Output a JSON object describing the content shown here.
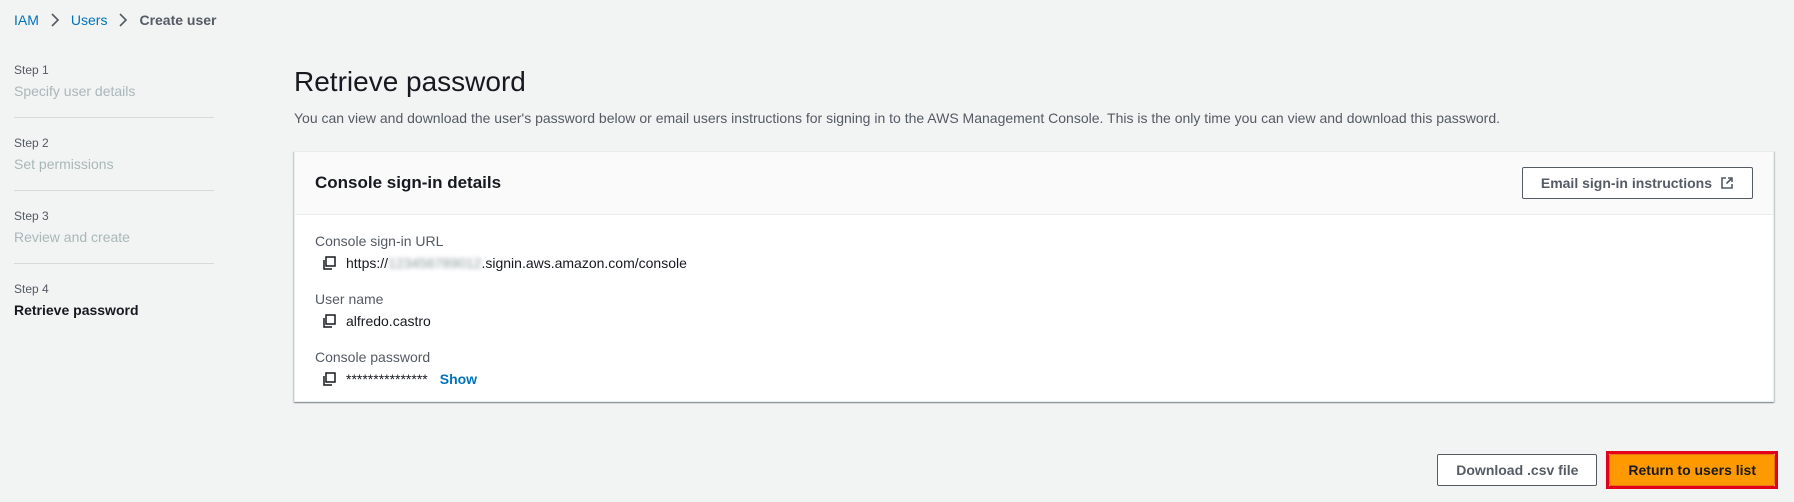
{
  "breadcrumb": {
    "items": [
      "IAM",
      "Users"
    ],
    "current": "Create user"
  },
  "steps": [
    {
      "num": "Step 1",
      "title": "Specify user details",
      "active": false
    },
    {
      "num": "Step 2",
      "title": "Set permissions",
      "active": false
    },
    {
      "num": "Step 3",
      "title": "Review and create",
      "active": false
    },
    {
      "num": "Step 4",
      "title": "Retrieve password",
      "active": true
    }
  ],
  "main": {
    "title": "Retrieve password",
    "description": "You can view and download the user's password below or email users instructions for signing in to the AWS Management Console. This is the only time you can view and download this password."
  },
  "panel": {
    "title": "Console sign-in details",
    "email_button": "Email sign-in instructions",
    "url_label": "Console sign-in URL",
    "url_prefix": "https://",
    "url_account": "123456789012",
    "url_suffix": ".signin.aws.amazon.com/console",
    "username_label": "User name",
    "username": "alfredo.castro",
    "password_label": "Console password",
    "password_masked": "***************",
    "show_label": "Show"
  },
  "actions": {
    "download": "Download .csv file",
    "return": "Return to users list"
  },
  "colors": {
    "link": "#0073bb",
    "primary": "#ff9900",
    "highlight": "#e3001b"
  }
}
